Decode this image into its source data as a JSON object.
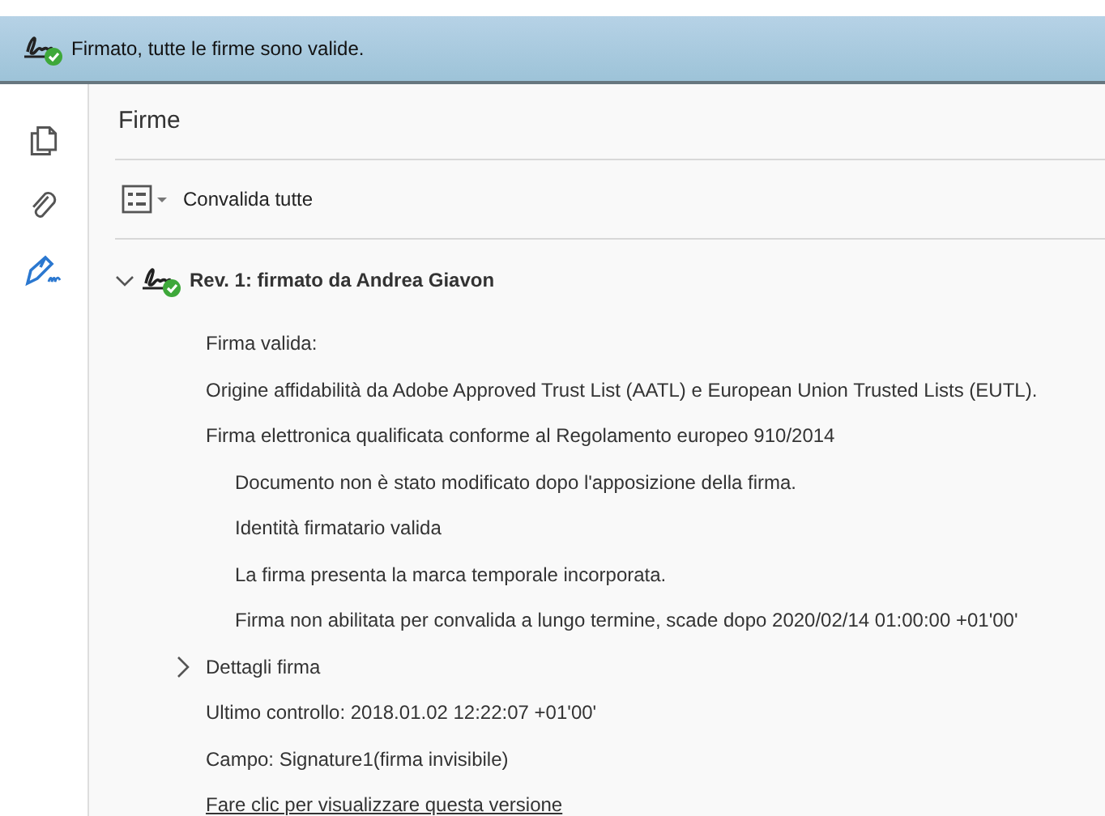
{
  "banner": {
    "text": "Firmato, tutte le firme sono valide."
  },
  "sidebar": {
    "items": [
      {
        "kind": "pages",
        "selected": false
      },
      {
        "kind": "attachments",
        "selected": false
      },
      {
        "kind": "signatures",
        "selected": true
      }
    ]
  },
  "panel": {
    "title": "Firme",
    "toolbar": {
      "label": "Convalida tutte"
    }
  },
  "signature": {
    "title": "Rev. 1: firmato da Andrea Giavon",
    "expanded": true,
    "valid": true,
    "items": [
      {
        "kind": "text",
        "text": "Firma valida:"
      },
      {
        "kind": "text",
        "text": "Origine affidabilità da Adobe Approved Trust List (AATL) e European Union Trusted Lists (EUTL)."
      },
      {
        "kind": "text",
        "text": "Firma elettronica qualificata conforme al Regolamento europeo 910/2014",
        "children": [
          {
            "text": "Documento non è stato modificato dopo l'apposizione della firma."
          },
          {
            "text": "Identità firmatario valida"
          },
          {
            "text": "La firma presenta la marca temporale incorporata."
          },
          {
            "text": "Firma non abilitata per convalida a lungo termine, scade dopo 2020/02/14 01:00:00 +01'00'"
          }
        ]
      },
      {
        "kind": "expander",
        "text": "Dettagli firma",
        "expanded": false
      },
      {
        "kind": "text",
        "text": "Ultimo controllo: 2018.01.02 12:22:07 +01'00'"
      },
      {
        "kind": "text",
        "text": "Campo: Signature1(firma invisibile)"
      },
      {
        "kind": "link",
        "text": "Fare clic per visualizzare questa versione"
      }
    ]
  }
}
